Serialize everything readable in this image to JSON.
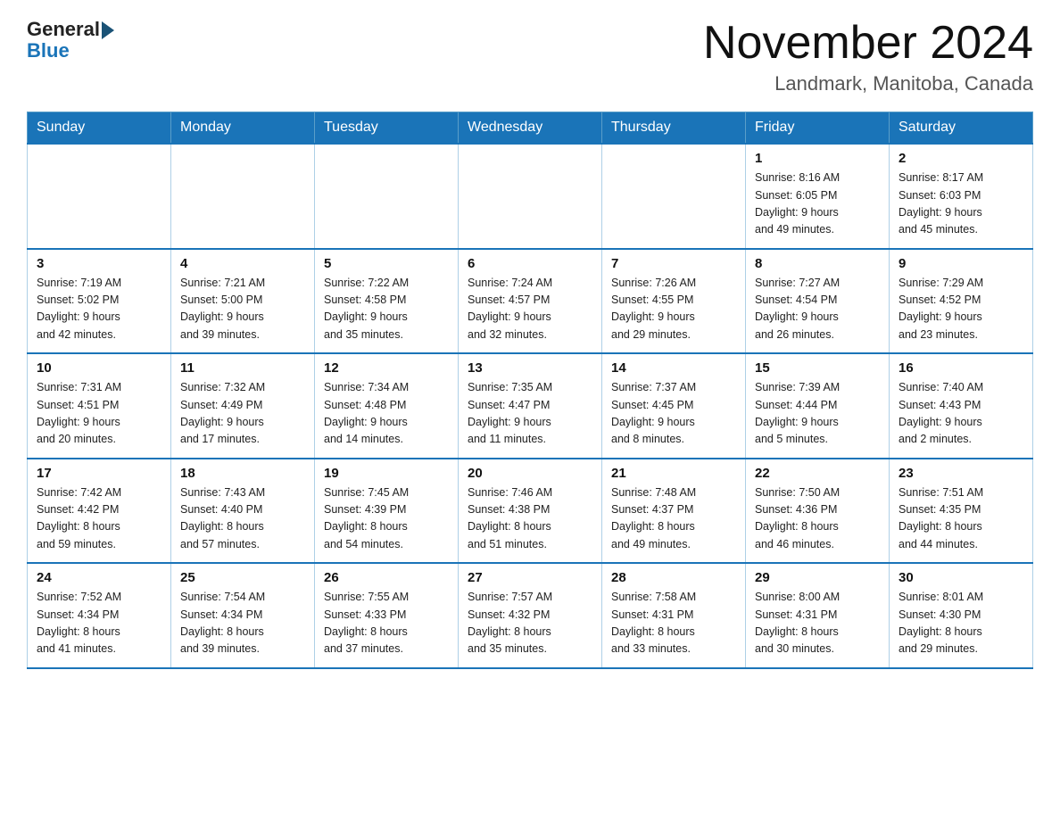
{
  "header": {
    "logo_general": "General",
    "logo_blue": "Blue",
    "month_title": "November 2024",
    "location": "Landmark, Manitoba, Canada"
  },
  "weekdays": [
    "Sunday",
    "Monday",
    "Tuesday",
    "Wednesday",
    "Thursday",
    "Friday",
    "Saturday"
  ],
  "weeks": [
    [
      {
        "day": "",
        "info": ""
      },
      {
        "day": "",
        "info": ""
      },
      {
        "day": "",
        "info": ""
      },
      {
        "day": "",
        "info": ""
      },
      {
        "day": "",
        "info": ""
      },
      {
        "day": "1",
        "info": "Sunrise: 8:16 AM\nSunset: 6:05 PM\nDaylight: 9 hours\nand 49 minutes."
      },
      {
        "day": "2",
        "info": "Sunrise: 8:17 AM\nSunset: 6:03 PM\nDaylight: 9 hours\nand 45 minutes."
      }
    ],
    [
      {
        "day": "3",
        "info": "Sunrise: 7:19 AM\nSunset: 5:02 PM\nDaylight: 9 hours\nand 42 minutes."
      },
      {
        "day": "4",
        "info": "Sunrise: 7:21 AM\nSunset: 5:00 PM\nDaylight: 9 hours\nand 39 minutes."
      },
      {
        "day": "5",
        "info": "Sunrise: 7:22 AM\nSunset: 4:58 PM\nDaylight: 9 hours\nand 35 minutes."
      },
      {
        "day": "6",
        "info": "Sunrise: 7:24 AM\nSunset: 4:57 PM\nDaylight: 9 hours\nand 32 minutes."
      },
      {
        "day": "7",
        "info": "Sunrise: 7:26 AM\nSunset: 4:55 PM\nDaylight: 9 hours\nand 29 minutes."
      },
      {
        "day": "8",
        "info": "Sunrise: 7:27 AM\nSunset: 4:54 PM\nDaylight: 9 hours\nand 26 minutes."
      },
      {
        "day": "9",
        "info": "Sunrise: 7:29 AM\nSunset: 4:52 PM\nDaylight: 9 hours\nand 23 minutes."
      }
    ],
    [
      {
        "day": "10",
        "info": "Sunrise: 7:31 AM\nSunset: 4:51 PM\nDaylight: 9 hours\nand 20 minutes."
      },
      {
        "day": "11",
        "info": "Sunrise: 7:32 AM\nSunset: 4:49 PM\nDaylight: 9 hours\nand 17 minutes."
      },
      {
        "day": "12",
        "info": "Sunrise: 7:34 AM\nSunset: 4:48 PM\nDaylight: 9 hours\nand 14 minutes."
      },
      {
        "day": "13",
        "info": "Sunrise: 7:35 AM\nSunset: 4:47 PM\nDaylight: 9 hours\nand 11 minutes."
      },
      {
        "day": "14",
        "info": "Sunrise: 7:37 AM\nSunset: 4:45 PM\nDaylight: 9 hours\nand 8 minutes."
      },
      {
        "day": "15",
        "info": "Sunrise: 7:39 AM\nSunset: 4:44 PM\nDaylight: 9 hours\nand 5 minutes."
      },
      {
        "day": "16",
        "info": "Sunrise: 7:40 AM\nSunset: 4:43 PM\nDaylight: 9 hours\nand 2 minutes."
      }
    ],
    [
      {
        "day": "17",
        "info": "Sunrise: 7:42 AM\nSunset: 4:42 PM\nDaylight: 8 hours\nand 59 minutes."
      },
      {
        "day": "18",
        "info": "Sunrise: 7:43 AM\nSunset: 4:40 PM\nDaylight: 8 hours\nand 57 minutes."
      },
      {
        "day": "19",
        "info": "Sunrise: 7:45 AM\nSunset: 4:39 PM\nDaylight: 8 hours\nand 54 minutes."
      },
      {
        "day": "20",
        "info": "Sunrise: 7:46 AM\nSunset: 4:38 PM\nDaylight: 8 hours\nand 51 minutes."
      },
      {
        "day": "21",
        "info": "Sunrise: 7:48 AM\nSunset: 4:37 PM\nDaylight: 8 hours\nand 49 minutes."
      },
      {
        "day": "22",
        "info": "Sunrise: 7:50 AM\nSunset: 4:36 PM\nDaylight: 8 hours\nand 46 minutes."
      },
      {
        "day": "23",
        "info": "Sunrise: 7:51 AM\nSunset: 4:35 PM\nDaylight: 8 hours\nand 44 minutes."
      }
    ],
    [
      {
        "day": "24",
        "info": "Sunrise: 7:52 AM\nSunset: 4:34 PM\nDaylight: 8 hours\nand 41 minutes."
      },
      {
        "day": "25",
        "info": "Sunrise: 7:54 AM\nSunset: 4:34 PM\nDaylight: 8 hours\nand 39 minutes."
      },
      {
        "day": "26",
        "info": "Sunrise: 7:55 AM\nSunset: 4:33 PM\nDaylight: 8 hours\nand 37 minutes."
      },
      {
        "day": "27",
        "info": "Sunrise: 7:57 AM\nSunset: 4:32 PM\nDaylight: 8 hours\nand 35 minutes."
      },
      {
        "day": "28",
        "info": "Sunrise: 7:58 AM\nSunset: 4:31 PM\nDaylight: 8 hours\nand 33 minutes."
      },
      {
        "day": "29",
        "info": "Sunrise: 8:00 AM\nSunset: 4:31 PM\nDaylight: 8 hours\nand 30 minutes."
      },
      {
        "day": "30",
        "info": "Sunrise: 8:01 AM\nSunset: 4:30 PM\nDaylight: 8 hours\nand 29 minutes."
      }
    ]
  ]
}
